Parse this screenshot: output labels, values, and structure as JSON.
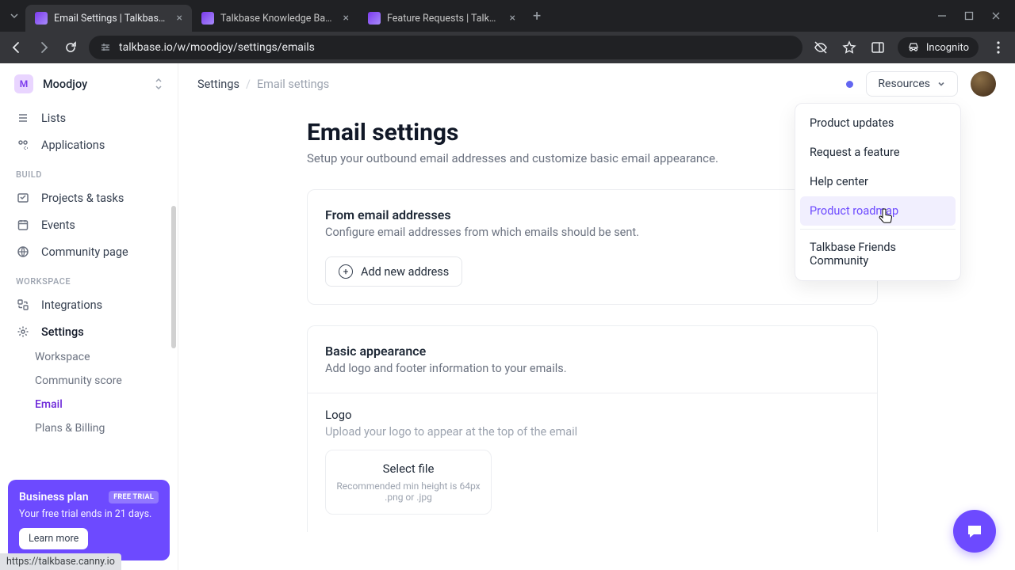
{
  "browser": {
    "tabs": [
      {
        "title": "Email Settings | Talkbase.io",
        "active": true
      },
      {
        "title": "Talkbase Knowledge Base",
        "active": false
      },
      {
        "title": "Feature Requests | Talkbase",
        "active": false
      }
    ],
    "url": "talkbase.io/w/moodjoy/settings/emails",
    "incognito_label": "Incognito",
    "status_url": "https://talkbase.canny.io"
  },
  "workspace": {
    "initial": "M",
    "name": "Moodjoy"
  },
  "sidebar": {
    "top": [
      {
        "icon": "list",
        "label": "Lists"
      },
      {
        "icon": "apps",
        "label": "Applications"
      }
    ],
    "build_label": "BUILD",
    "build": [
      {
        "icon": "projects",
        "label": "Projects & tasks"
      },
      {
        "icon": "calendar",
        "label": "Events"
      },
      {
        "icon": "globe",
        "label": "Community page"
      }
    ],
    "workspace_label": "WORKSPACE",
    "workspace": [
      {
        "icon": "integrations",
        "label": "Integrations"
      },
      {
        "icon": "settings",
        "label": "Settings",
        "active": true
      }
    ],
    "settings_sub": [
      {
        "label": "Workspace",
        "active": false
      },
      {
        "label": "Community score",
        "active": false
      },
      {
        "label": "Email",
        "active": true
      },
      {
        "label": "Plans & Billing",
        "active": false
      }
    ]
  },
  "promo": {
    "title": "Business plan",
    "badge": "FREE TRIAL",
    "sub": "Your free trial ends in 21 days.",
    "cta": "Learn more"
  },
  "breadcrumb": {
    "root": "Settings",
    "current": "Email settings"
  },
  "resources": {
    "label": "Resources",
    "items": [
      "Product updates",
      "Request a feature",
      "Help center",
      "Product roadmap"
    ],
    "highlighted_index": 3,
    "footer_item": "Talkbase Friends Community"
  },
  "page": {
    "title": "Email settings",
    "sub": "Setup your outbound email addresses and customize basic email appearance."
  },
  "from_card": {
    "title": "From email addresses",
    "sub": "Configure email addresses from which emails should be sent.",
    "add_button": "Add new address"
  },
  "appearance_card": {
    "title": "Basic appearance",
    "sub": "Add logo and footer information to your emails.",
    "logo_label": "Logo",
    "logo_hint": "Upload your logo to appear at the top of the email",
    "select_file": "Select file",
    "rec1": "Recommended min height is 64px",
    "rec2": ".png or .jpg"
  }
}
